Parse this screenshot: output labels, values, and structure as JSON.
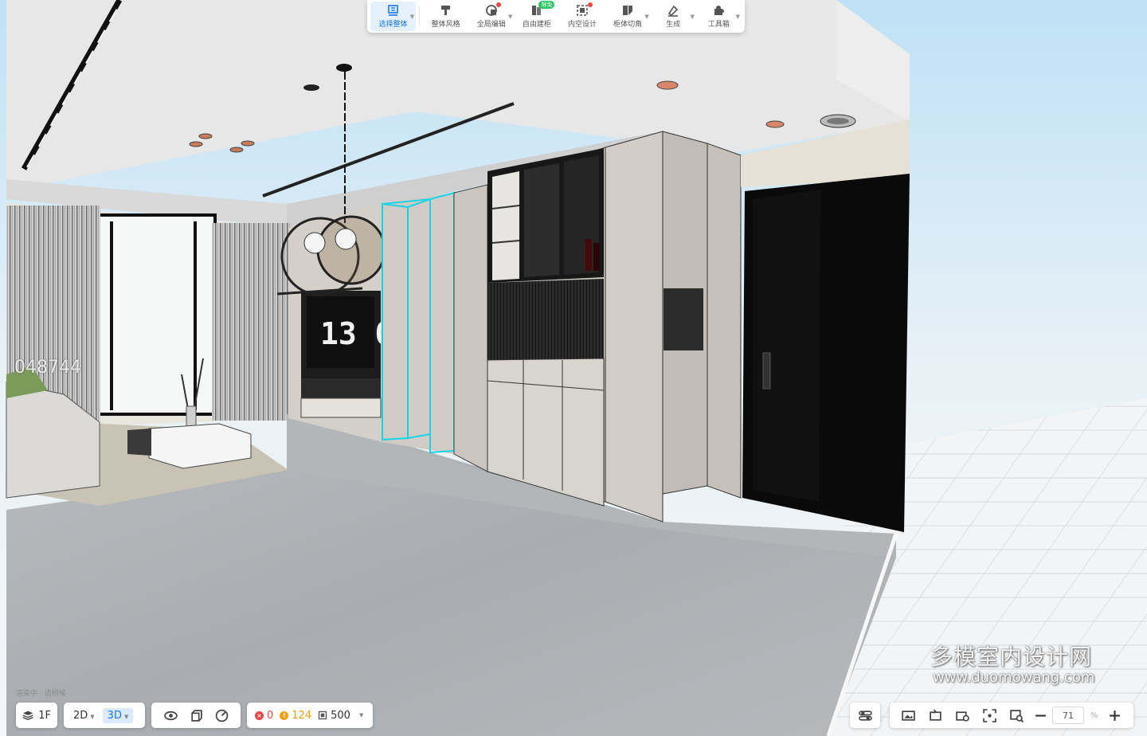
{
  "toolbar": {
    "items": [
      {
        "label": "选择整体",
        "icon": "select-icon",
        "active": true,
        "caret": true
      },
      {
        "label": "整体风格",
        "icon": "style-icon"
      },
      {
        "label": "全局编辑",
        "icon": "global-edit-icon",
        "dot": true,
        "caret": true
      },
      {
        "label": "自由建柜",
        "icon": "free-cabinet-icon",
        "badge": "限免"
      },
      {
        "label": "内空设计",
        "icon": "inner-space-icon",
        "dot": true
      },
      {
        "label": "柜体切角",
        "icon": "cabinet-cut-icon",
        "caret": true
      },
      {
        "label": "生成",
        "icon": "generate-icon",
        "caret": true
      },
      {
        "label": "工具箱",
        "icon": "toolbox-icon",
        "caret": true
      }
    ]
  },
  "scene": {
    "clock_text": "13 00",
    "watermark_id": "048744"
  },
  "brand": {
    "cn": "多模室内设计网",
    "url": "www.duomowang.com"
  },
  "render_hint": "渲染中 · 请稍候",
  "bottom": {
    "floor_label": "1F",
    "view_2d": "2D",
    "view_3d": "3D",
    "errors": "0",
    "warnings": "124",
    "models": "500",
    "zoom_value": "71",
    "zoom_unit": "%"
  },
  "colors": {
    "accent": "#1677ff",
    "error": "#ef4444",
    "warning": "#f59e0b",
    "selection": "#19d3e6"
  }
}
